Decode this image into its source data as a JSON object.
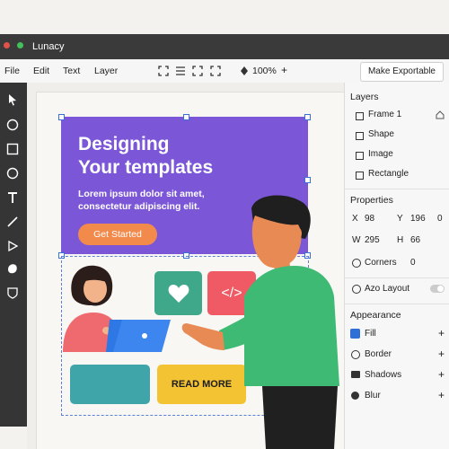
{
  "app": {
    "title": "Lunacy"
  },
  "menubar": {
    "items": [
      "File",
      "Edit",
      "Text",
      "Layer"
    ],
    "zoom": "100%",
    "zoom_plus": "+",
    "export_button": "Make Exportable"
  },
  "toolbar": {
    "tools": [
      "pointer-icon",
      "circle-icon",
      "square-icon",
      "circle-icon",
      "text-icon",
      "line-icon",
      "play-icon",
      "blob-icon",
      "shield-icon"
    ]
  },
  "canvas": {
    "headline_line1": "Designing",
    "headline_line2": "Your templates",
    "lorem_line1": "Lorem ipsum dolor sit amet,",
    "lorem_line2": "consectetur adipiscing elit.",
    "cta": "Get Started",
    "code_tile": "</>",
    "read_more": "READ MORE"
  },
  "layers": {
    "title": "Layers",
    "items": [
      "Frame 1",
      "Shape",
      "Image",
      "Rectangle"
    ]
  },
  "properties": {
    "title": "Properties",
    "x_label": "X",
    "x_value": "98",
    "y_label": "Y",
    "y_value": "196",
    "rotation": "0",
    "w_label": "W",
    "w_value": "295",
    "h_label": "H",
    "h_value": "66",
    "corners_label": "Corners",
    "corners_value": "0",
    "auto_layout": "Azo Layout"
  },
  "appearance": {
    "title": "Appearance",
    "items": [
      "Fill",
      "Border",
      "Shadows",
      "Blur"
    ],
    "add": "+"
  },
  "colors": {
    "banner": "#7b57d8",
    "cta": "#f28a4c",
    "fill_swatch": "#2f6fd6"
  }
}
